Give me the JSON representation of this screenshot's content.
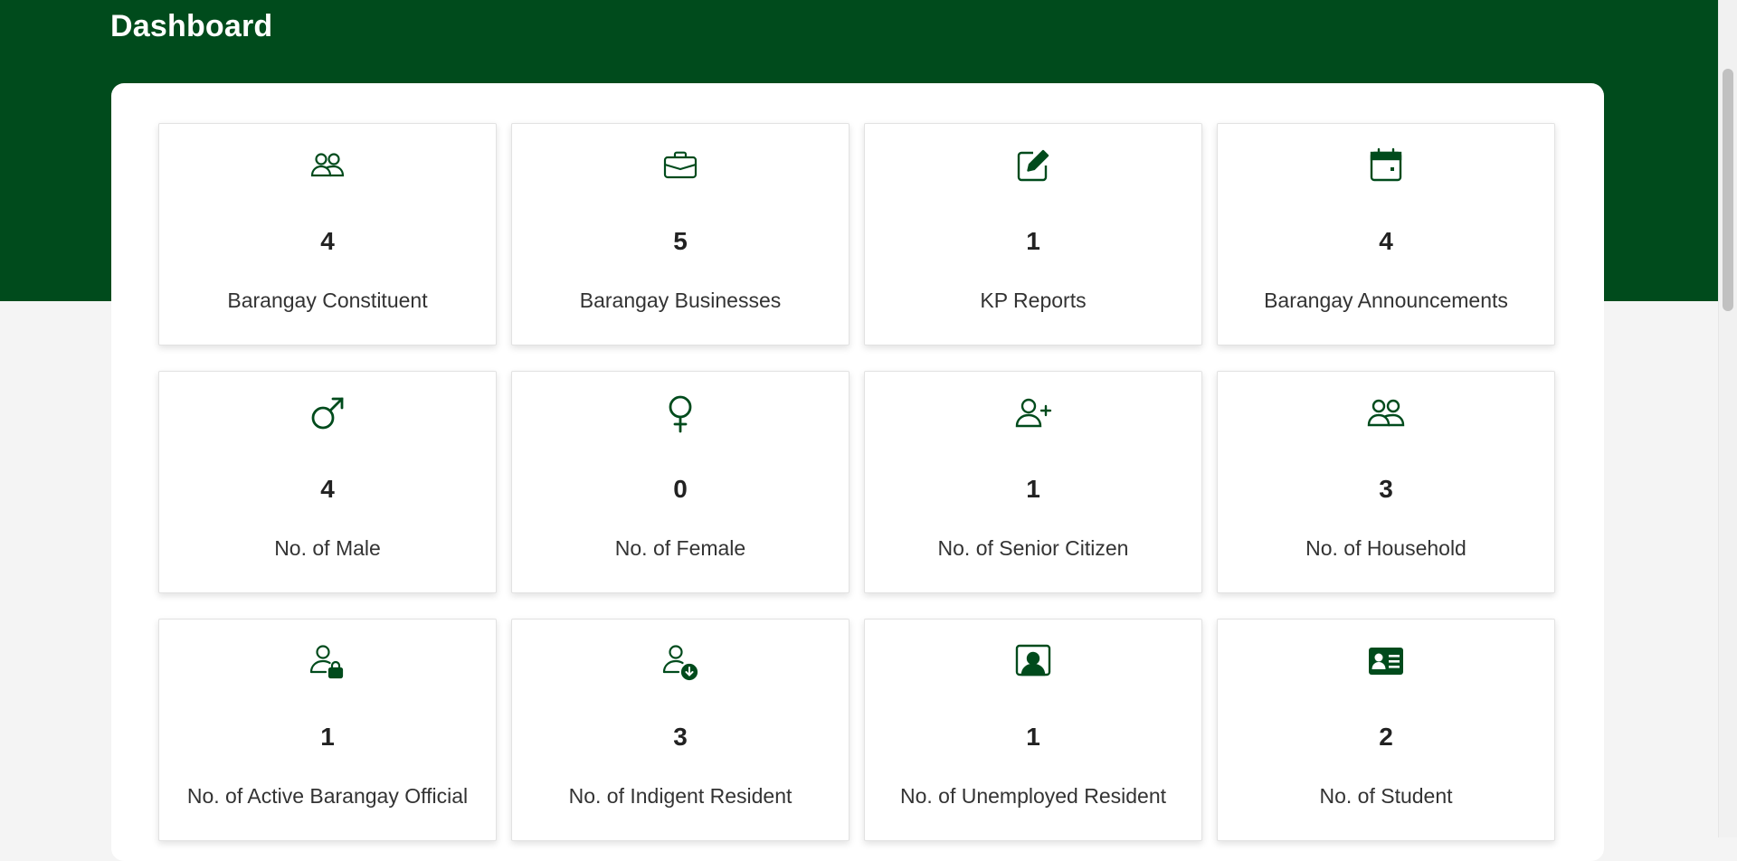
{
  "page": {
    "title": "Dashboard"
  },
  "theme": {
    "primary": "#004b1c",
    "background": "#f4f4f4"
  },
  "cards": [
    {
      "icon": "people-icon",
      "count": "4",
      "label": "Barangay Constituent"
    },
    {
      "icon": "briefcase-icon",
      "count": "5",
      "label": "Barangay Businesses"
    },
    {
      "icon": "edit-icon",
      "count": "1",
      "label": "KP Reports"
    },
    {
      "icon": "calendar-icon",
      "count": "4",
      "label": "Barangay Announcements"
    },
    {
      "icon": "male-icon",
      "count": "4",
      "label": "No. of Male"
    },
    {
      "icon": "female-icon",
      "count": "0",
      "label": "No. of Female"
    },
    {
      "icon": "person-plus-icon",
      "count": "1",
      "label": "No. of Senior Citizen"
    },
    {
      "icon": "people-icon",
      "count": "3",
      "label": "No. of Household"
    },
    {
      "icon": "person-lock-icon",
      "count": "1",
      "label": "No. of Active Barangay Official"
    },
    {
      "icon": "person-down-icon",
      "count": "3",
      "label": "No. of Indigent Resident"
    },
    {
      "icon": "person-video-icon",
      "count": "1",
      "label": "No. of Unemployed Resident"
    },
    {
      "icon": "id-card-icon",
      "count": "2",
      "label": "No. of Student"
    }
  ]
}
